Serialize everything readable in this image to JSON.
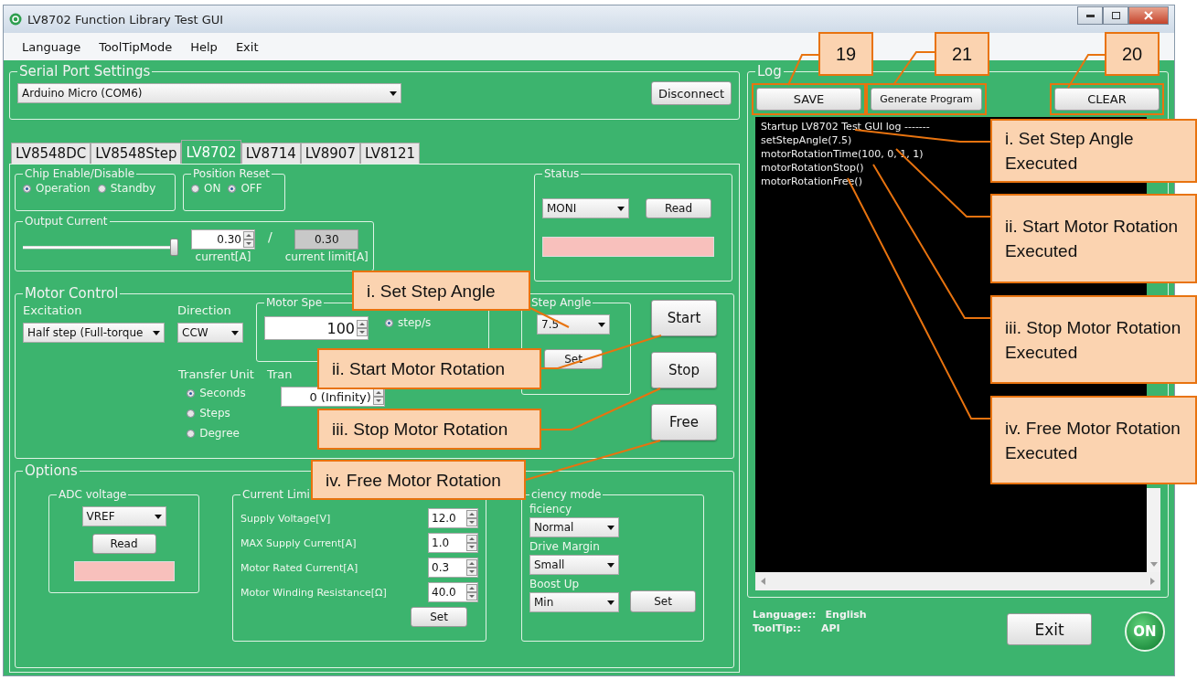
{
  "window": {
    "title": "LV8702 Function Library Test GUI"
  },
  "menu": [
    {
      "label": "Language"
    },
    {
      "label": "ToolTipMode"
    },
    {
      "label": "Help"
    },
    {
      "label": "Exit"
    }
  ],
  "serial_port": {
    "title": "Serial Port Settings",
    "port": "Arduino Micro (COM6)",
    "button": "Disconnect"
  },
  "tabs": [
    {
      "label": "LV8548DC",
      "selected": false
    },
    {
      "label": "LV8548Step",
      "selected": false
    },
    {
      "label": "LV8702",
      "selected": true
    },
    {
      "label": "LV8714",
      "selected": false
    },
    {
      "label": "LV8907",
      "selected": false
    },
    {
      "label": "LV8121",
      "selected": false
    }
  ],
  "chip_enable": {
    "title": "Chip Enable/Disable",
    "options": [
      {
        "label": "Operation",
        "selected": true
      },
      {
        "label": "Standby",
        "selected": false
      }
    ]
  },
  "position_reset": {
    "title": "Position Reset",
    "options": [
      {
        "label": "ON",
        "selected": false
      },
      {
        "label": "OFF",
        "selected": true
      }
    ]
  },
  "output_current": {
    "title": "Output Current",
    "level": 1,
    "current": "0.30",
    "separator": "/",
    "limit": "0.30",
    "current_label": "current[A]",
    "limit_label": "current limit[A]"
  },
  "status": {
    "title": "Status",
    "select": "MONI",
    "button": "Read"
  },
  "motor_control": {
    "title": "Motor Control",
    "excitation_label": "Excitation",
    "excitation": "Half step (Full-torque",
    "direction_label": "Direction",
    "direction": "CCW",
    "speed_title": "Motor Spe",
    "speed": "100",
    "speed_units": [
      {
        "label": "step/s",
        "selected": true
      }
    ],
    "transfer_unit_label": "Transfer Unit",
    "transfer_units": [
      {
        "label": "Seconds",
        "selected": true
      },
      {
        "label": "Steps",
        "selected": false
      },
      {
        "label": "Degree",
        "selected": false
      }
    ],
    "transfer_label": "Tran",
    "transfer_value": "0 (Infinity)",
    "step_angle_title": "Step Angle",
    "step_angle": "7.5",
    "set": "Set",
    "buttons": [
      {
        "label": "Start"
      },
      {
        "label": "Stop"
      },
      {
        "label": "Free"
      }
    ]
  },
  "options": {
    "title": "Options",
    "adc": {
      "title": "ADC voltage",
      "select": "VREF",
      "button": "Read"
    },
    "current_limit": {
      "title": "Current Limi",
      "rows": [
        {
          "label": "Supply Voltage[V]",
          "value": "12.0"
        },
        {
          "label": "MAX Supply Current[A]",
          "value": "1.0"
        },
        {
          "label": "Motor Rated Current[A]",
          "value": "0.3"
        },
        {
          "label": "Motor Winding Resistance[Ω]",
          "value": "40.0"
        }
      ],
      "button": "Set"
    },
    "efficiency": {
      "title": "ciency mode",
      "fields": [
        {
          "label": "ficiency",
          "value": "Normal"
        },
        {
          "label": "Drive Margin",
          "value": "Small"
        },
        {
          "label": "Boost Up",
          "value": "Min"
        }
      ],
      "button": "Set"
    }
  },
  "log": {
    "title": "Log",
    "buttons": [
      {
        "label": "SAVE"
      },
      {
        "label": "Generate Program"
      },
      {
        "label": "CLEAR"
      }
    ],
    "lines": [
      "Startup LV8702 Test GUI log -------",
      "setStepAngle(7.5)",
      "motorRotationTime(100, 0, 1, 1)",
      "motorRotationStop()",
      "motorRotationFree()"
    ]
  },
  "footer": {
    "language_label": "Language::",
    "language": "English",
    "tooltip_label": "ToolTip::",
    "tooltip": "API",
    "exit": "Exit",
    "logo": "ON"
  },
  "annotations": {
    "numbers": [
      {
        "label": "19"
      },
      {
        "label": "21"
      },
      {
        "label": "20"
      }
    ],
    "steps": [
      {
        "label": "i. Set Step Angle"
      },
      {
        "label": "ii. Start Motor Rotation"
      },
      {
        "label": "iii. Stop Motor Rotation"
      },
      {
        "label": "iv. Free Motor Rotation"
      }
    ],
    "results": [
      {
        "label": "i. Set Step Angle Executed"
      },
      {
        "label": "ii. Start Motor Rotation Executed"
      },
      {
        "label": "iii. Stop Motor Rotation Executed"
      },
      {
        "label": "iv. Free Motor Rotation Executed"
      }
    ]
  }
}
